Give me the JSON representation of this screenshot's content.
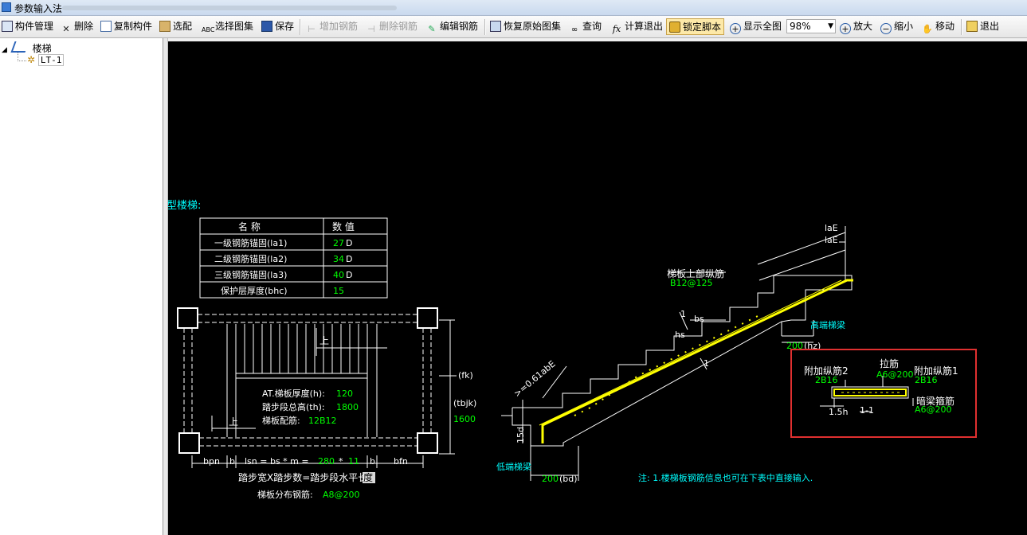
{
  "window": {
    "title": "参数输入法"
  },
  "toolbar": {
    "component_manage": "构件管理",
    "delete": "删除",
    "copy_component": "复制构件",
    "select_match": "选配",
    "select_atlas": "选择图集",
    "save": "保存",
    "add_rebar": "增加钢筋",
    "delete_rebar": "删除钢筋",
    "edit_rebar": "编辑钢筋",
    "restore_atlas": "恢复原始图集",
    "query": "查询",
    "calc_exit": "计算退出",
    "lock_script": "锁定脚本",
    "show_all": "显示全图",
    "zoom_value": "98%",
    "zoom_in": "放大",
    "zoom_out": "缩小",
    "move": "移动",
    "exit": "退出"
  },
  "tree": {
    "root": "楼梯",
    "child": "LT-1"
  },
  "drawing": {
    "heading": "型楼梯:",
    "table": {
      "headers": [
        "名 称",
        "数 值"
      ],
      "rows": [
        {
          "name": "一级钢筋锚固(la1)",
          "value": "27",
          "unit": "D"
        },
        {
          "name": "二级钢筋锚固(la2)",
          "value": "34",
          "unit": "D"
        },
        {
          "name": "三级钢筋锚固(la3)",
          "value": "40",
          "unit": "D"
        },
        {
          "name": "保护层厚度(bhc)",
          "value": "15",
          "unit": ""
        }
      ]
    },
    "plan": {
      "up1": "上",
      "up2": "上",
      "thickness_label": "AT.梯板厚度(h):",
      "thickness_value": "120",
      "height_label": "踏步段总高(th):",
      "height_value": "1800",
      "rebar_label": "梯板配筋:",
      "rebar_value": "12B12",
      "fk": "(fk)",
      "tbjk": "(tbjk)",
      "tbjk_value": "1600",
      "bpn": "bpn",
      "b1": "b",
      "lsn_formula": "lsn = bs * m =",
      "lsn_bs": "280",
      "lsn_times": "*",
      "lsn_m": "11",
      "b2": "b",
      "bfn": "bfn",
      "caption": "踏步宽X踏步数=踏步段水平长",
      "caption_highlight": "度",
      "dist_rebar_label": "梯板分布钢筋:",
      "dist_rebar_value": "A8@200"
    },
    "section": {
      "top_rebar_label": "梯板上部纵筋",
      "top_rebar_value": "B12@125",
      "lae1": "laE",
      "lae2": "laE",
      "bs": "bs",
      "hs": "hs",
      "one1": "1",
      "one2": "1",
      "high_beam": "高端梯梁",
      "dim_200a": "200",
      "hz": "(hz)",
      "anchor": ">=0.61abE",
      "d15": "15d",
      "low_beam": "低端梯梁",
      "dim_200b": "200",
      "bd": "(bd)"
    },
    "detail": {
      "add_long2": "附加纵筋2",
      "add_long2_val": "2B16",
      "tie": "拉筋",
      "tie_val": "A6@200",
      "add_long1": "附加纵筋1",
      "add_long1_val": "2B16",
      "hidden_stirrup": "暗梁箍筋",
      "hidden_stirrup_val": "A6@200",
      "dim": "1.5h",
      "section_label": "1-1"
    },
    "note": "注: 1.楼梯板钢筋信息也可在下表中直接输入.",
    "colors": {
      "line": "#ffffff",
      "value": "#00ff00",
      "label": "#00ffff",
      "rebar": "#ffff00",
      "highlight_box": "#e03030"
    }
  }
}
